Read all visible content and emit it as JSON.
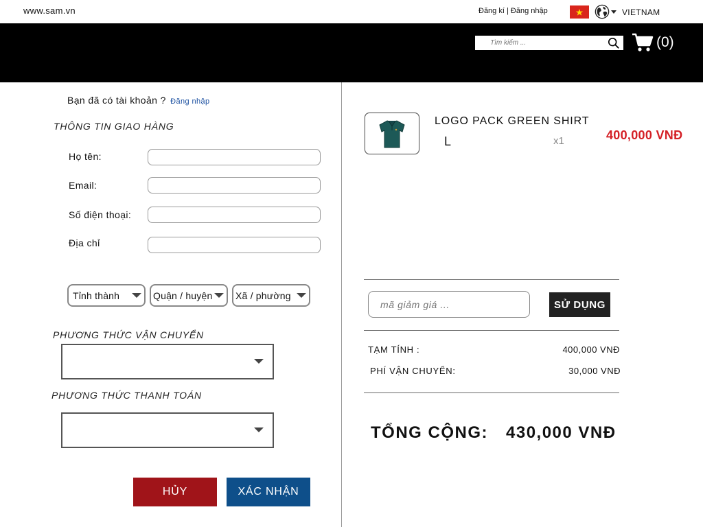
{
  "topbar": {
    "site_url": "www.sam.vn",
    "register": "Đăng kí",
    "separator": "|",
    "login": "Đăng nhập",
    "country": "VIETNAM",
    "flag_icon": "vietnam-flag-icon",
    "globe_icon": "globe-icon"
  },
  "header": {
    "background": "#000000",
    "search_placeholder": "Tìm kiếm ...",
    "cart_count": "(0)",
    "cart_icon": "cart-icon"
  },
  "checkout": {
    "have_account": "Bạn đã có tài khoản ?",
    "login_link": "Đăng nhập",
    "shipping_info_title": "THÔNG TIN GIAO HÀNG",
    "fields": {
      "name_label": "Họ tên:",
      "email_label": "Email:",
      "phone_label": "Số điện thoại:",
      "address_label": "Địa chỉ"
    },
    "selects": {
      "province": "Tỉnh thành",
      "district": "Quận / huyện",
      "ward": "Xã / phường"
    },
    "shipping_method_title": "PHƯƠNG THỨC VẬN CHUYỂN",
    "payment_method_title": "PHƯƠNG THỨC THANH TOÁN",
    "cancel_label": "HỦY",
    "confirm_label": "XÁC NHẬN",
    "cancel_color": "#a01419",
    "confirm_color": "#0e4f8a"
  },
  "order": {
    "product": {
      "name": "LOGO PACK GREEN SHIRT",
      "size": "L",
      "quantity": "x1",
      "price": "400,000 VNĐ",
      "price_color": "#d42026",
      "thumb_icon": "green-polo-shirt-icon"
    },
    "coupon_placeholder": "mã giảm giá ...",
    "apply_label": "SỬ DỤNG",
    "subtotal_label": "TẠM TÍNH :",
    "subtotal_value": "400,000 VNĐ",
    "shipping_fee_label": "PHÍ VẬN CHUYỂN:",
    "shipping_fee_value": "30,000 VNĐ",
    "total_label": "TỔNG CỘNG:",
    "total_value": "430,000 VNĐ"
  }
}
